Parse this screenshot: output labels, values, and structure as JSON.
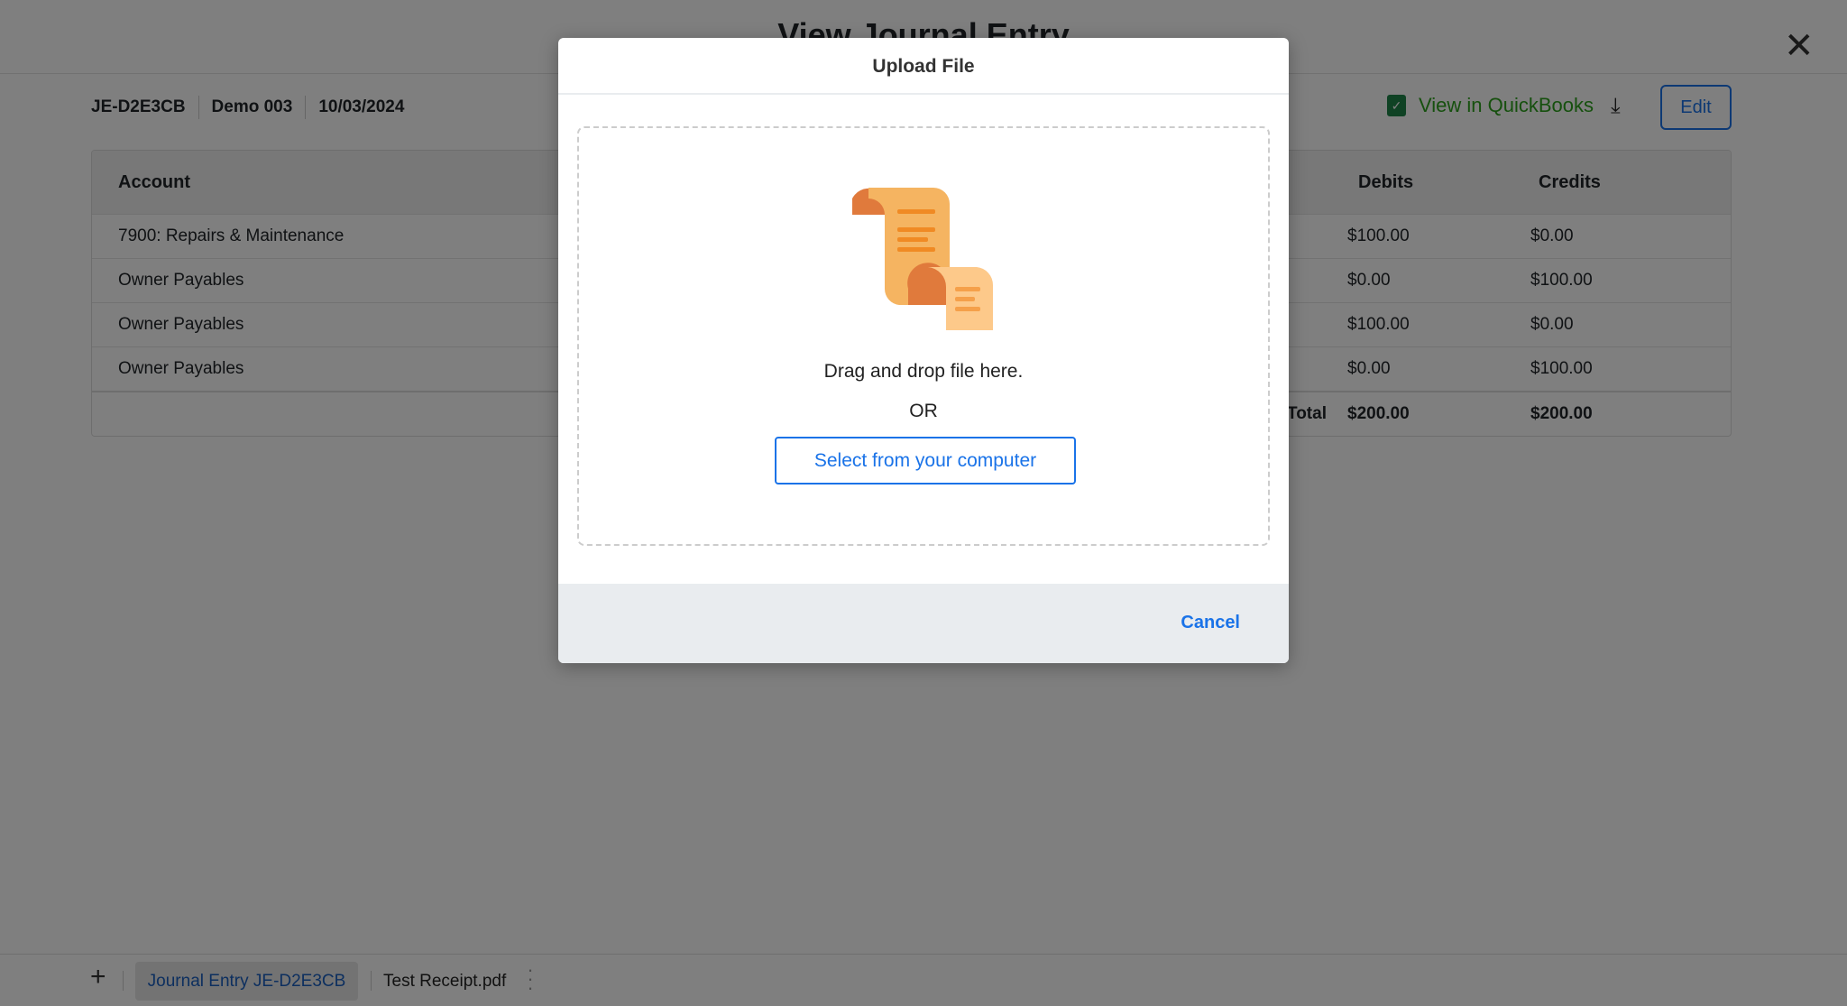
{
  "page": {
    "title": "View Journal Entry",
    "meta": {
      "id": "JE-D2E3CB",
      "name": "Demo 003",
      "date": "10/03/2024"
    },
    "quickbooks_label": "View in QuickBooks",
    "edit_label": "Edit",
    "close_icon": "✕",
    "download_icon": "⤓",
    "table": {
      "headers": {
        "account": "Account",
        "debits": "Debits",
        "credits": "Credits"
      },
      "rows": [
        {
          "account": "7900: Repairs & Maintenance",
          "debit": "$100.00",
          "credit": "$0.00"
        },
        {
          "account": "Owner Payables",
          "debit": "$0.00",
          "credit": "$100.00"
        },
        {
          "account": "Owner Payables",
          "debit": "$100.00",
          "credit": "$0.00"
        },
        {
          "account": "Owner Payables",
          "debit": "$0.00",
          "credit": "$100.00"
        }
      ],
      "total": {
        "label": "Total",
        "debit": "$200.00",
        "credit": "$200.00"
      }
    }
  },
  "bottom_tabs": {
    "add_icon": "+",
    "tabs": [
      {
        "label": "Journal Entry JE-D2E3CB",
        "active": true
      },
      {
        "label": "Test Receipt.pdf",
        "active": false
      }
    ]
  },
  "modal": {
    "title": "Upload File",
    "drop_text": "Drag and drop file here.",
    "or_text": "OR",
    "select_label": "Select from your computer",
    "cancel_label": "Cancel"
  },
  "colors": {
    "accent": "#1a73e8",
    "quickbooks_green": "#2ca01c",
    "illustration_orange": "#f5b461"
  }
}
